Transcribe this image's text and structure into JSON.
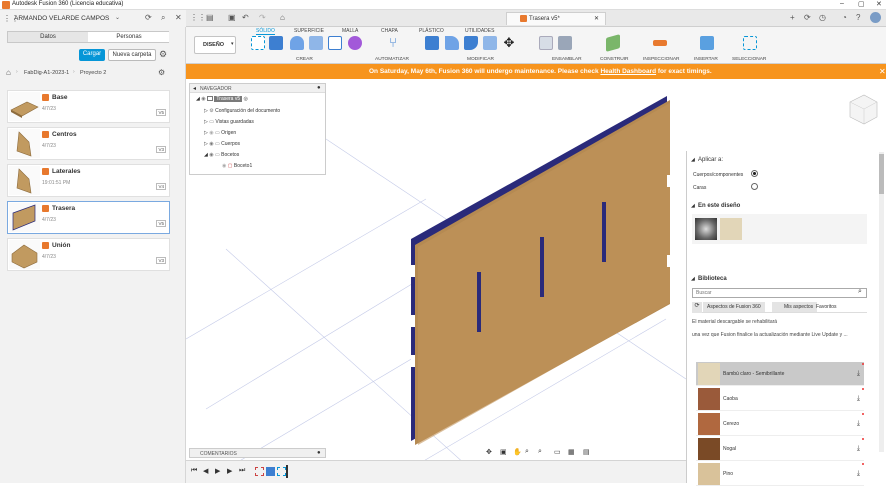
{
  "window": {
    "title": "Autodesk Fusion 360 (Licencia educativa)",
    "minimize": "–",
    "maximize": "▢",
    "close": "✕"
  },
  "user": {
    "name": "ARMANDO VELARDE CAMPOS"
  },
  "panel_tabs": {
    "data": "Datos",
    "people": "Personas"
  },
  "actions": {
    "upload": "Cargar",
    "new_project": "Nueva carpeta"
  },
  "breadcrumb": {
    "root": "FabDig-A1-2023-1",
    "sep": "›",
    "project": "Proyecto 2"
  },
  "files": [
    {
      "name": "Base",
      "date": "4/7/23",
      "version": "V5"
    },
    {
      "name": "Centros",
      "date": "4/7/23",
      "version": "V3"
    },
    {
      "name": "Laterales",
      "date": "19:01:51 PM",
      "version": "V4"
    },
    {
      "name": "Trasera",
      "date": "4/7/23",
      "version": "V5"
    },
    {
      "name": "Unión",
      "date": "4/7/23",
      "version": "V3"
    }
  ],
  "doc_tab": {
    "title": "Trasera v5*"
  },
  "ribbon": {
    "workspace": "DISEÑO",
    "tabs": [
      "SÓLIDO",
      "SUPERFICIE",
      "MALLA",
      "CHAPA",
      "PLÁSTICO",
      "UTILIDADES"
    ],
    "groups": [
      "CREAR",
      "AUTOMATIZAR",
      "MODIFICAR",
      "ENSAMBLAR",
      "CONSTRUIR",
      "INSPECCIONAR",
      "INSERTAR",
      "SELECCIONAR"
    ]
  },
  "banner": {
    "text_before": "On Saturday, May 6th, Fusion 360 will undergo maintenance. Please check ",
    "link": "Health Dashboard",
    "text_after": " for exact timings."
  },
  "browser": {
    "title": "NAVEGADOR",
    "root": "Trasera v5",
    "items": [
      "Configuración del documento",
      "Vistas guardadas",
      "Origen",
      "Cuerpos",
      "Bocetos",
      "Boceto1"
    ]
  },
  "comments": {
    "title": "COMENTARIOS"
  },
  "appearance": {
    "apply_to_label": "Aplicar a:",
    "opt_bodies": "Cuerpos/componentes",
    "opt_faces": "Caras",
    "in_design": "En este diseño",
    "library": "Biblioteca",
    "search_placeholder": "Buscar",
    "lib_tabs": [
      "Aspectos de Fusion 360",
      "Mis aspectos",
      "Favoritos"
    ],
    "note1": "El material descargable se rehabilitará",
    "note2": "una vez que Fusion finalice la actualización mediante Live Update y ...",
    "materials": [
      "Bambú claro - Semibrillante",
      "Caoba",
      "Cerezo",
      "Nogal",
      "Pino"
    ]
  },
  "colors": {
    "accent": "#0696d7",
    "banner": "#f7941d",
    "wood": "#b58a52",
    "edge": "#2a2a7a"
  }
}
